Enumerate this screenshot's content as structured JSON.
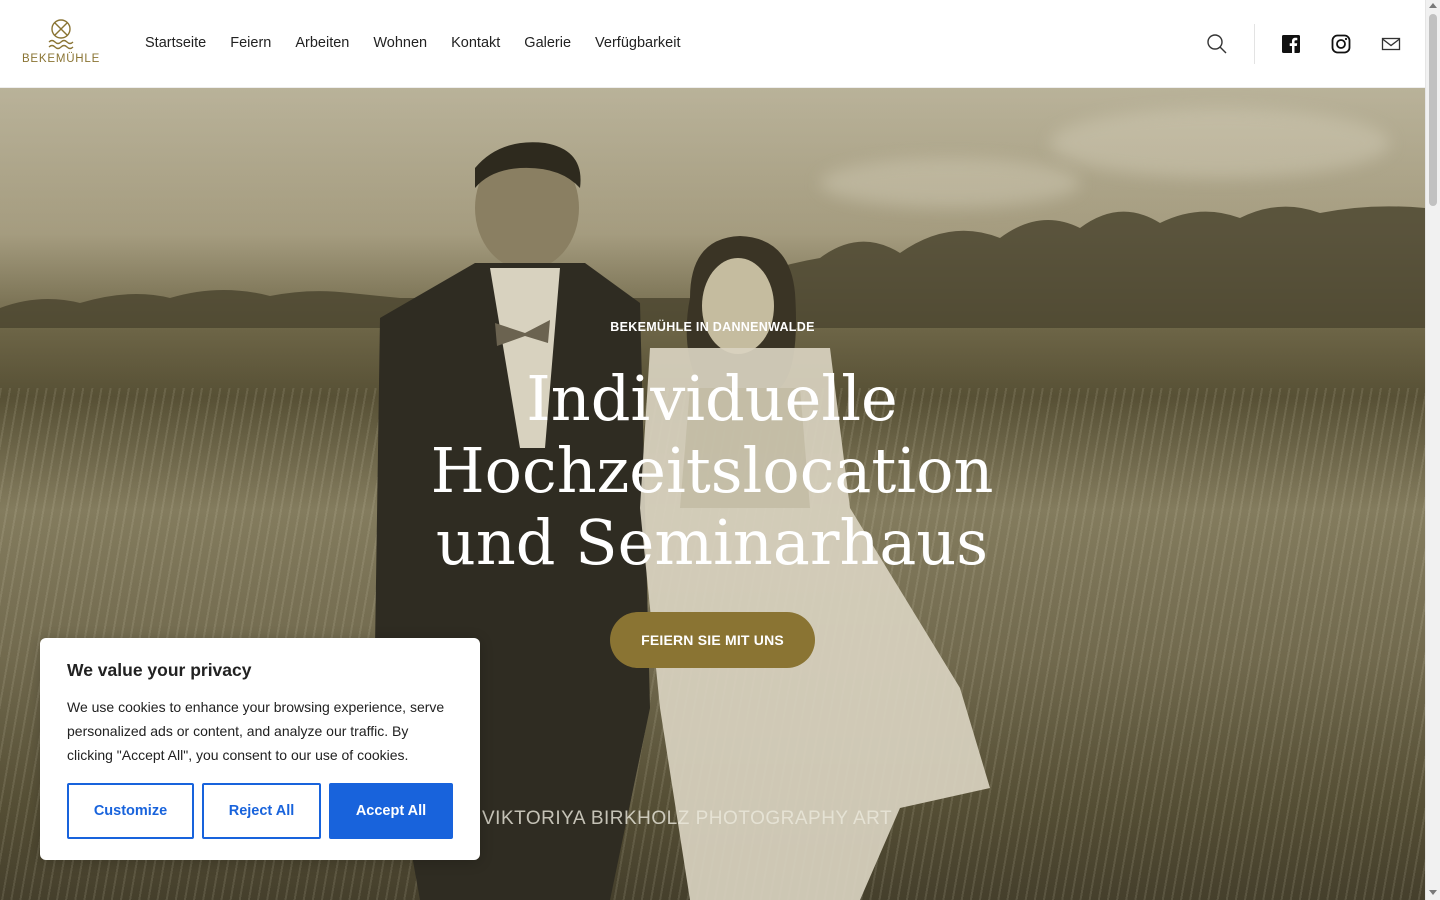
{
  "brand": {
    "name": "BEKEMÜHLE",
    "accent_color": "#8a7433"
  },
  "nav": {
    "items": [
      {
        "label": "Startseite"
      },
      {
        "label": "Feiern"
      },
      {
        "label": "Arbeiten"
      },
      {
        "label": "Wohnen"
      },
      {
        "label": "Kontakt"
      },
      {
        "label": "Galerie"
      },
      {
        "label": "Verfügbarkeit"
      }
    ]
  },
  "header_icons": [
    "search-icon",
    "facebook-icon",
    "instagram-icon",
    "mail-icon"
  ],
  "hero": {
    "kicker": "BEKEMÜHLE IN DANNENWALDE",
    "title": "Individuelle Hochzeitslocation und Seminarhaus",
    "cta_label": "FEIERN SIE MIT UNS",
    "photo_credit": "VIKTORIYA BIRKHOLZ PHOTOGRAPHY ART"
  },
  "cookie_banner": {
    "title": "We value your privacy",
    "text": "We use cookies to enhance your browsing experience, serve personalized ads or content, and analyze our traffic. By clicking \"Accept All\", you consent to our use of cookies.",
    "customize_label": "Customize",
    "reject_label": "Reject All",
    "accept_label": "Accept All",
    "button_color": "#1863dc"
  }
}
